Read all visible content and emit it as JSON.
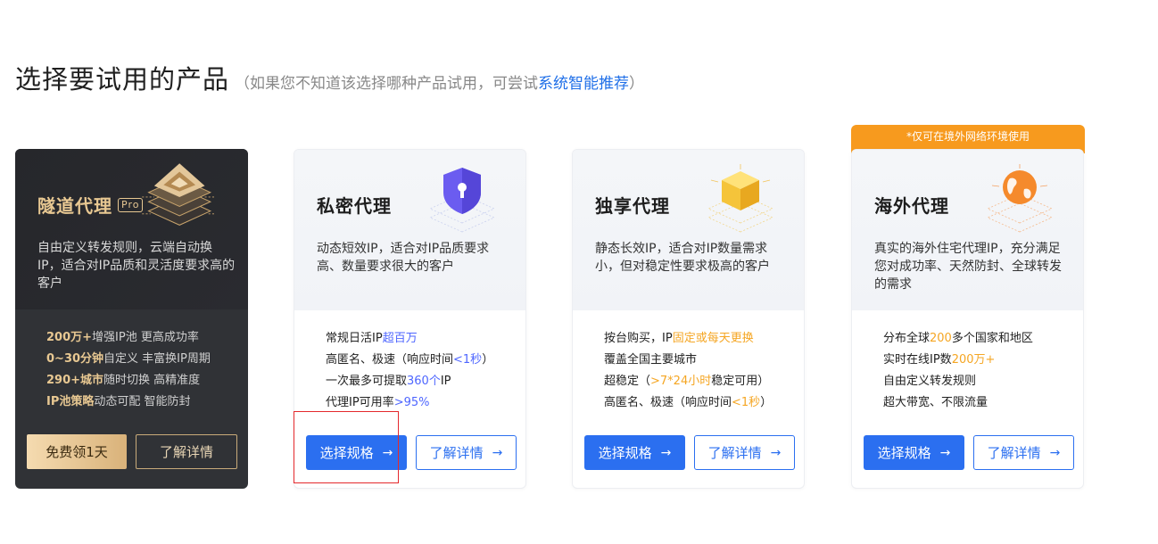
{
  "header": {
    "title": "选择要试用的产品",
    "subtitle_prefix": "（如果您不知道该选择哪种产品试用，可尝试",
    "subtitle_link": "系统智能推荐",
    "subtitle_suffix": "）"
  },
  "tunnel": {
    "name": "隧道代理",
    "badge": "Pro",
    "desc": "自由定义转发规则，云端自动换IP，适合对IP品质和灵活度要求高的客户",
    "features": [
      {
        "strong": "200万+",
        "text": "增强IP池 更高成功率"
      },
      {
        "strong": "0~30分钟",
        "text": "自定义 丰富换IP周期"
      },
      {
        "strong": "290+城市",
        "text": "随时切换 高精准度"
      },
      {
        "strong": "IP池策略",
        "text": "动态可配 智能防封"
      }
    ],
    "primary_label": "免费领1天",
    "secondary_label": "了解详情"
  },
  "private": {
    "name": "私密代理",
    "desc": "动态短效IP，适合对IP品质要求高、数量要求很大的客户",
    "features": [
      {
        "pre": "常规日活IP",
        "hl": "超百万",
        "post": ""
      },
      {
        "pre": "高匿名、极速（响应时间",
        "hl": "<1秒",
        "post": "）"
      },
      {
        "pre": "一次最多可提取",
        "hl": "360个",
        "post": "IP"
      },
      {
        "pre": "代理IP可用率",
        "hl": ">95%",
        "post": ""
      }
    ],
    "primary_label": "选择规格",
    "secondary_label": "了解详情"
  },
  "exclusive": {
    "name": "独享代理",
    "desc": "静态长效IP，适合对IP数量需求小，但对稳定性要求极高的客户",
    "features": [
      {
        "pre": "按台购买，IP",
        "hl": "固定或每天更换",
        "post": ""
      },
      {
        "pre": "覆盖全国主要城市",
        "hl": "",
        "post": ""
      },
      {
        "pre": "超稳定（",
        "hl": ">7*24小时",
        "post": "稳定可用）"
      },
      {
        "pre": "高匿名、极速（响应时间",
        "hl": "<1秒",
        "post": "）"
      }
    ],
    "primary_label": "选择规格",
    "secondary_label": "了解详情"
  },
  "overseas": {
    "tag": "*仅可在境外网络环境使用",
    "name": "海外代理",
    "desc": "真实的海外住宅代理IP，充分满足您对成功率、天然防封、全球转发的需求",
    "features": [
      {
        "pre": "分布全球",
        "hl": "200",
        "post": "多个国家和地区"
      },
      {
        "pre": "实时在线IP数",
        "hl": "200万+",
        "post": ""
      },
      {
        "pre": "自由定义转发规则",
        "hl": "",
        "post": ""
      },
      {
        "pre": "超大带宽、不限流量",
        "hl": "",
        "post": ""
      }
    ],
    "primary_label": "选择规格",
    "secondary_label": "了解详情"
  },
  "colors": {
    "accent": "#2b6ff0",
    "gold": "#e8c892",
    "orange": "#f79a1e",
    "highlight_red": "#e4292c"
  },
  "icons": {
    "arrow": "→"
  }
}
